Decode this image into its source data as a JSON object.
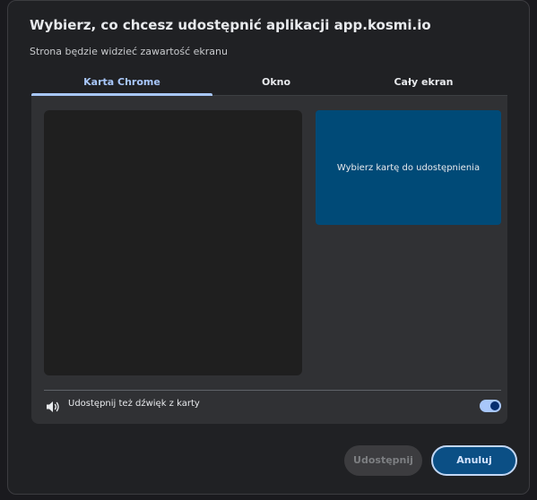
{
  "dialog": {
    "title": "Wybierz, co chcesz udostępnić aplikacji app.kosmi.io",
    "subtitle": "Strona będzie widzieć zawartość ekranu"
  },
  "tabs": [
    {
      "label": "Karta Chrome",
      "active": true
    },
    {
      "label": "Okno",
      "active": false
    },
    {
      "label": "Cały ekran",
      "active": false
    }
  ],
  "tab_card": {
    "label": "Wybierz kartę do udostępnienia"
  },
  "audio": {
    "label": "Udostępnij też dźwięk z karty",
    "enabled": true,
    "icon": "speaker-icon"
  },
  "buttons": {
    "share_label": "Udostępnij",
    "share_enabled": false,
    "cancel_label": "Anuluj"
  },
  "colors": {
    "accent": "#a8c7fa",
    "tab_card_bg": "#004a77",
    "dialog_bg": "#202124",
    "panel_bg": "#303134"
  }
}
